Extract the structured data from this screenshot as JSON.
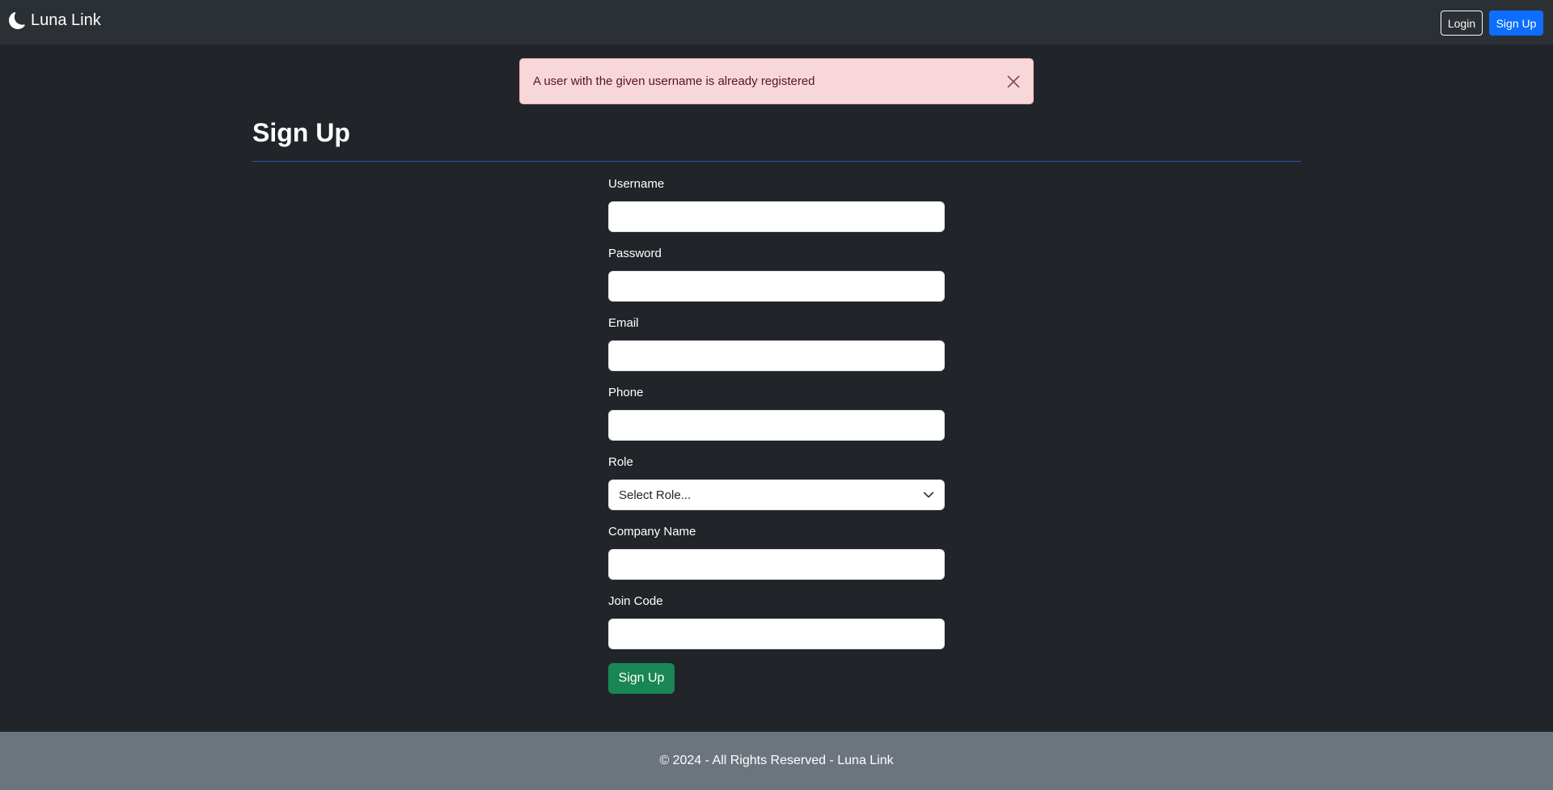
{
  "navbar": {
    "brand": "Luna Link",
    "brand_icon": "moon-icon",
    "login_label": "Login",
    "signup_label": "Sign Up"
  },
  "alert": {
    "message": "A user with the given username is already registered",
    "close_icon": "close-icon"
  },
  "page": {
    "title": "Sign Up"
  },
  "form": {
    "fields": [
      {
        "label": "Username",
        "value": "",
        "placeholder": ""
      },
      {
        "label": "Password",
        "value": "",
        "placeholder": ""
      },
      {
        "label": "Email",
        "value": "",
        "placeholder": ""
      },
      {
        "label": "Phone",
        "value": "",
        "placeholder": ""
      },
      {
        "label": "Role",
        "selected": "Select Role..."
      },
      {
        "label": "Company Name",
        "value": "",
        "placeholder": ""
      },
      {
        "label": "Join Code",
        "value": "",
        "placeholder": ""
      }
    ],
    "submit_label": "Sign Up"
  },
  "footer": {
    "text": "© 2024 - All Rights Reserved - Luna Link"
  },
  "colors": {
    "primary": "#0d6efd",
    "success": "#198754",
    "alert_bg": "#f8d7da",
    "footer_bg": "#6c757d"
  }
}
